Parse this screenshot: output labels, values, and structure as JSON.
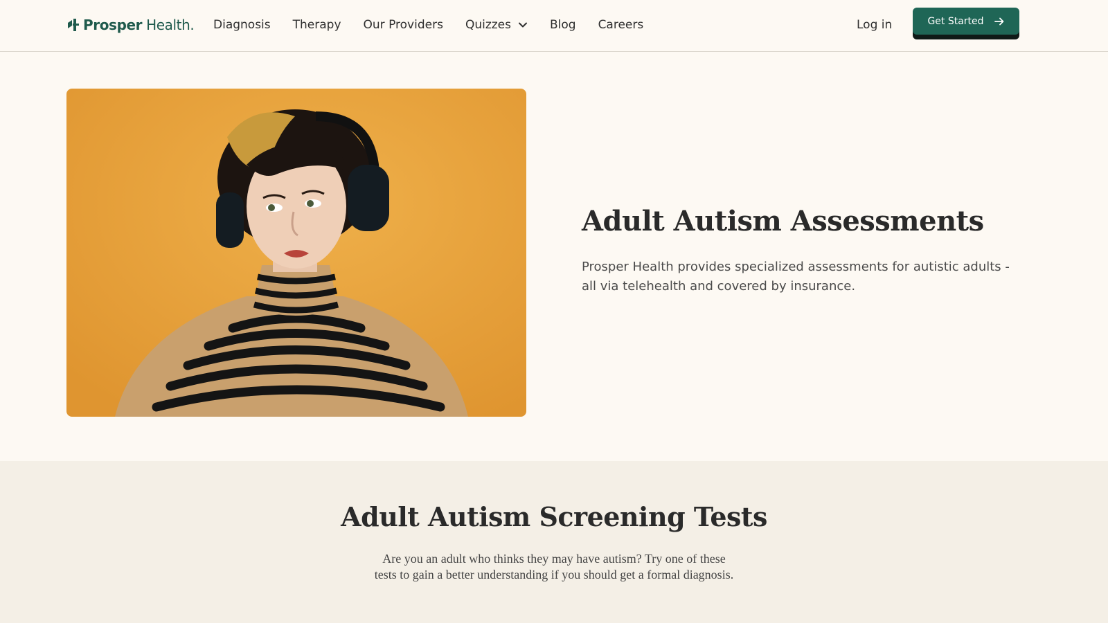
{
  "brand": {
    "name_bold": "Prosper",
    "name_rest": " Health.",
    "color": "#1f5a4c"
  },
  "nav": {
    "items": [
      {
        "label": "Diagnosis"
      },
      {
        "label": "Therapy"
      },
      {
        "label": "Our Providers"
      },
      {
        "label": "Quizzes",
        "has_dropdown": true
      },
      {
        "label": "Blog"
      },
      {
        "label": "Careers"
      }
    ],
    "login_label": "Log in",
    "cta_label": "Get Started",
    "cta_color": "#1f6656"
  },
  "hero": {
    "image_background": "#e9a23b",
    "title": "Adult Autism Assessments",
    "description": "Prosper Health provides specialized assessments for autistic adults - all via telehealth and covered by insurance."
  },
  "screening": {
    "title": "Adult Autism Screening Tests",
    "description": "Are you an adult who thinks they may have autism? Try one of these tests to gain a better understanding if you should get a formal diagnosis."
  }
}
